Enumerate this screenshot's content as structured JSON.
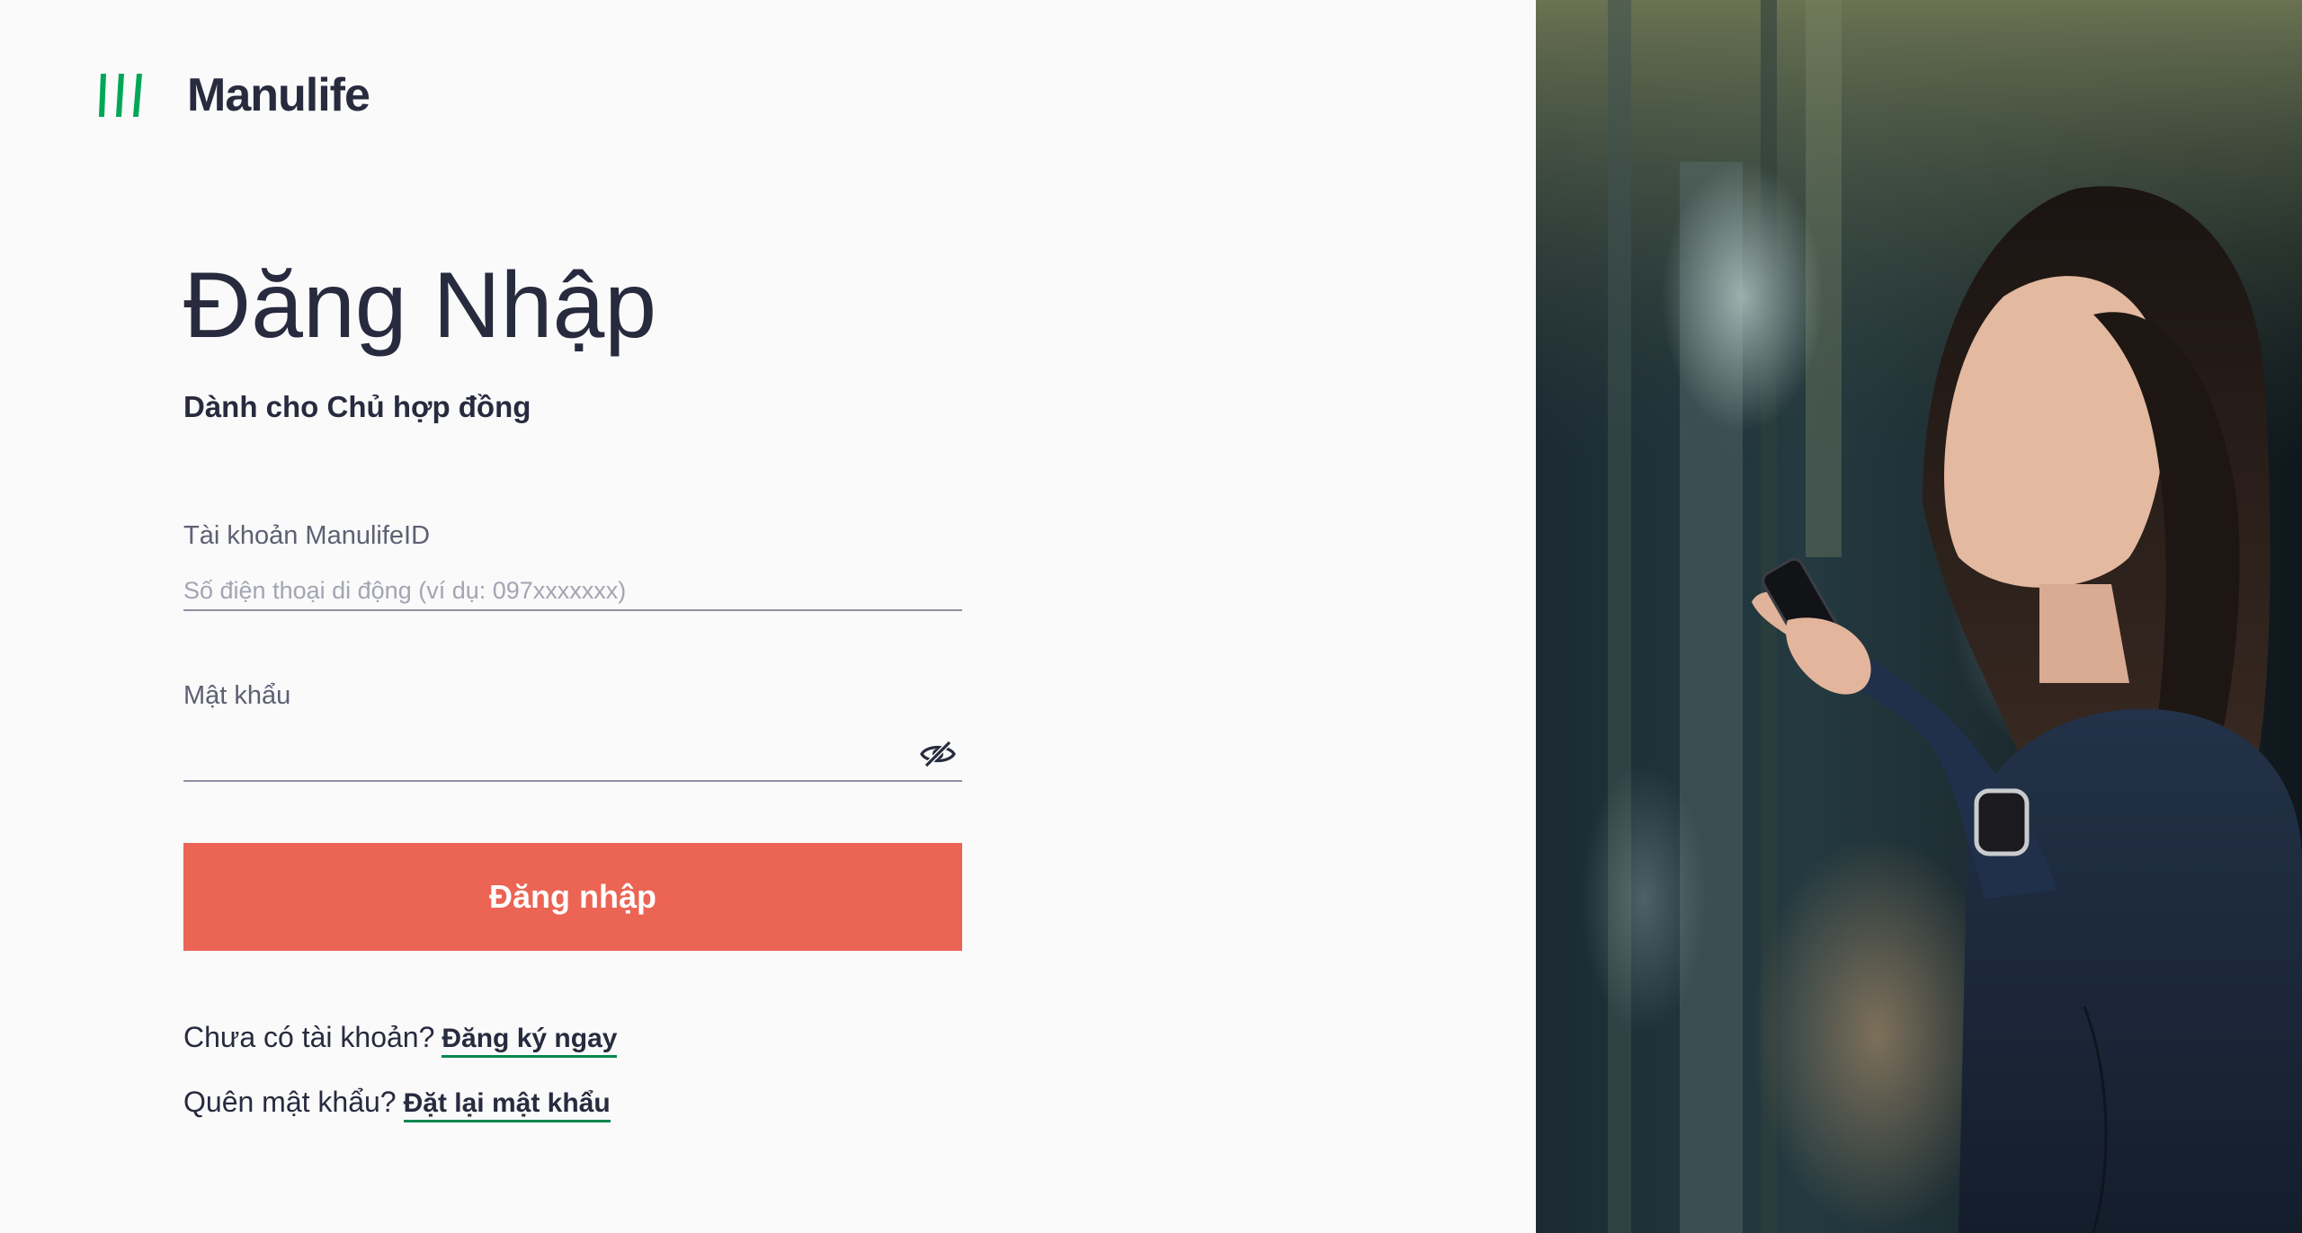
{
  "brand": {
    "name": "Manulife",
    "logo_color": "#00a758"
  },
  "login": {
    "title": "Đăng Nhập",
    "subtitle": "Dành cho Chủ hợp đồng",
    "account_label": "Tài khoản ManulifeID",
    "account_placeholder": "Số điện thoại di động (ví dụ: 097xxxxxxx)",
    "account_value": "",
    "password_label": "Mật khẩu",
    "password_value": "",
    "toggle_icon": "eye-slash-icon",
    "submit_label": "Đăng nhập",
    "submit_color": "#ec6453"
  },
  "links": {
    "register_prompt": "Chưa có tài khoản?",
    "register_link": "Đăng ký ngay",
    "reset_prompt": "Quên mật khẩu?",
    "reset_link": "Đặt lại mật khẩu",
    "underline_color": "#06874e"
  },
  "hero": {
    "image": "woman-with-smartphone-photo"
  }
}
